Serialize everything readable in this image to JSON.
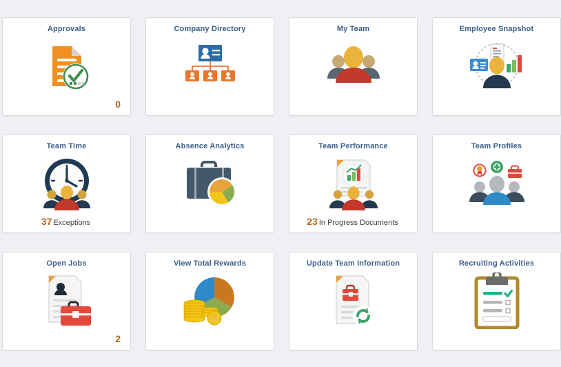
{
  "page": {
    "background_color": "#eff0f3",
    "tile_background": "#ffffff",
    "title_color": "#3b5e8c",
    "count_color": "#b7661a"
  },
  "tiles": [
    {
      "title": "Approvals",
      "icon": "document-approved-icon",
      "count": "0",
      "count_label": "",
      "footer_align": "right"
    },
    {
      "title": "Company Directory",
      "icon": "org-chart-contact-card-icon",
      "count": "",
      "count_label": "",
      "footer_align": "right"
    },
    {
      "title": "My Team",
      "icon": "team-people-icon",
      "count": "",
      "count_label": "",
      "footer_align": "right"
    },
    {
      "title": "Employee Snapshot",
      "icon": "employee-snapshot-icon",
      "count": "",
      "count_label": "",
      "footer_align": "right"
    },
    {
      "title": "Team Time",
      "icon": "clock-team-icon",
      "count": "37",
      "count_label": "Exceptions",
      "footer_align": "center"
    },
    {
      "title": "Absence Analytics",
      "icon": "briefcase-piechart-icon",
      "count": "",
      "count_label": "",
      "footer_align": "right"
    },
    {
      "title": "Team Performance",
      "icon": "performance-chart-team-icon",
      "count": "23",
      "count_label": "In Progress Documents",
      "footer_align": "center"
    },
    {
      "title": "Team Profiles",
      "icon": "team-profiles-icon",
      "count": "",
      "count_label": "",
      "footer_align": "right"
    },
    {
      "title": "Open Jobs",
      "icon": "resume-briefcase-icon",
      "count": "2",
      "count_label": "",
      "footer_align": "right"
    },
    {
      "title": "View Total Rewards",
      "icon": "piechart-coins-icon",
      "count": "",
      "count_label": "",
      "footer_align": "right"
    },
    {
      "title": "Update Team Information",
      "icon": "document-refresh-icon",
      "count": "",
      "count_label": "",
      "footer_align": "right"
    },
    {
      "title": "Recruiting Activities",
      "icon": "clipboard-checklist-icon",
      "count": "",
      "count_label": "",
      "footer_align": "right"
    }
  ]
}
